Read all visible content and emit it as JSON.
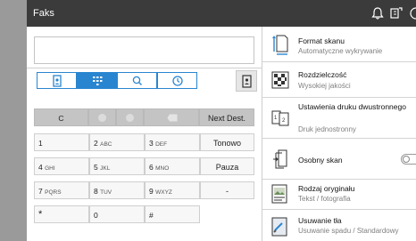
{
  "header": {
    "title": "Faks"
  },
  "left": {
    "dest_value": "",
    "tabs": [
      {
        "icon": "address-book-icon",
        "active": false
      },
      {
        "icon": "keypad-icon",
        "active": true
      },
      {
        "icon": "search-icon",
        "active": false
      },
      {
        "icon": "history-icon",
        "active": false
      }
    ],
    "keypad": {
      "clear": "C",
      "next_dest": "Next Dest.",
      "keys": [
        {
          "digit": "1",
          "letters": ""
        },
        {
          "digit": "2",
          "letters": "ABC"
        },
        {
          "digit": "3",
          "letters": "DEF"
        },
        {
          "digit": "4",
          "letters": "GHI"
        },
        {
          "digit": "5",
          "letters": "JKL"
        },
        {
          "digit": "6",
          "letters": "MNO"
        },
        {
          "digit": "7",
          "letters": "PQRS"
        },
        {
          "digit": "8",
          "letters": "TUV"
        },
        {
          "digit": "9",
          "letters": "WXYZ"
        },
        {
          "digit": "*",
          "letters": ""
        },
        {
          "digit": "0",
          "letters": ""
        },
        {
          "digit": "#",
          "letters": ""
        }
      ],
      "side": [
        "Tonowo",
        "Pauza",
        "-"
      ]
    }
  },
  "settings": [
    {
      "name": "Format skanu",
      "value": "Automatyczne wykrywanie",
      "icon": "scan-size-icon"
    },
    {
      "name": "Rozdzielczość",
      "value": "Wysokiej jakości",
      "icon": "resolution-icon"
    },
    {
      "name": "Ustawienia druku dwustronnego",
      "value": "Druk jednostronny",
      "icon": "duplex-icon"
    },
    {
      "name": "Osobny skan",
      "value": "",
      "icon": "separate-scan-icon",
      "toggle": false
    },
    {
      "name": "Rodzaj oryginału",
      "value": "Tekst / fotografia",
      "icon": "original-type-icon"
    },
    {
      "name": "Usuwanie tła",
      "value": "Usuwanie spadu / Standardowy",
      "icon": "background-removal-icon"
    }
  ]
}
